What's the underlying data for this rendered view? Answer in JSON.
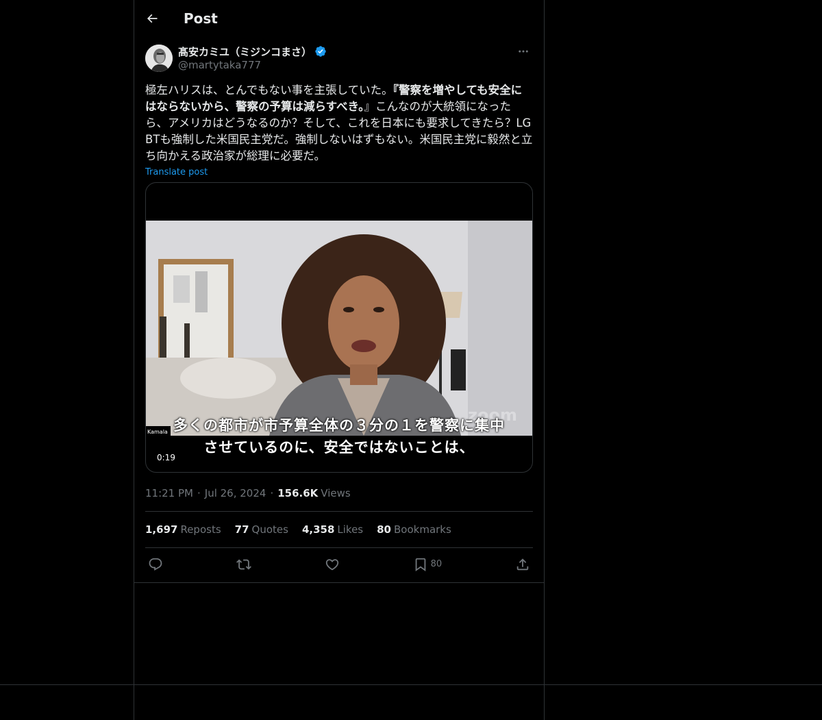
{
  "header": {
    "title": "Post"
  },
  "author": {
    "display_name": "髙安カミユ（ミジンコまさ）",
    "handle": "@martytaka777"
  },
  "post": {
    "text_normal_1": "極左ハリスは、とんでもない事を主張していた。",
    "text_bold": "『警察を増やしても安全にはならないから、警察の予算は減らすべき。",
    "text_normal_2": "』こんなのが大統領になったら、アメリカはどうなるのか？そして、これを日本にも要求してきたら？LGBTも強制した米国民主党だ。強制しないはずもない。米国民主党に毅然と立ち向かえる政治家が総理に必要だ。",
    "translate_label": "Translate post"
  },
  "media": {
    "duration": "0:19",
    "subtitle_line_1": "多くの都市が市予算全体の３分の１を警察に集中",
    "subtitle_line_2": "させているのに、安全ではないことは、",
    "watermark": "zoom",
    "nameplate": "Kamala"
  },
  "meta": {
    "time": "11:21 PM",
    "date": "Jul 26, 2024",
    "views_count": "156.6K",
    "views_label": "Views"
  },
  "stats": {
    "reposts_count": "1,697",
    "reposts_label": "Reposts",
    "quotes_count": "77",
    "quotes_label": "Quotes",
    "likes_count": "4,358",
    "likes_label": "Likes",
    "bookmarks_count": "80",
    "bookmarks_label": "Bookmarks"
  },
  "actions": {
    "bookmark_count": "80"
  },
  "colors": {
    "background": "#000000",
    "text": "#e7e9ea",
    "muted": "#71767b",
    "accent": "#1d9bf0",
    "border": "#2f3336"
  }
}
